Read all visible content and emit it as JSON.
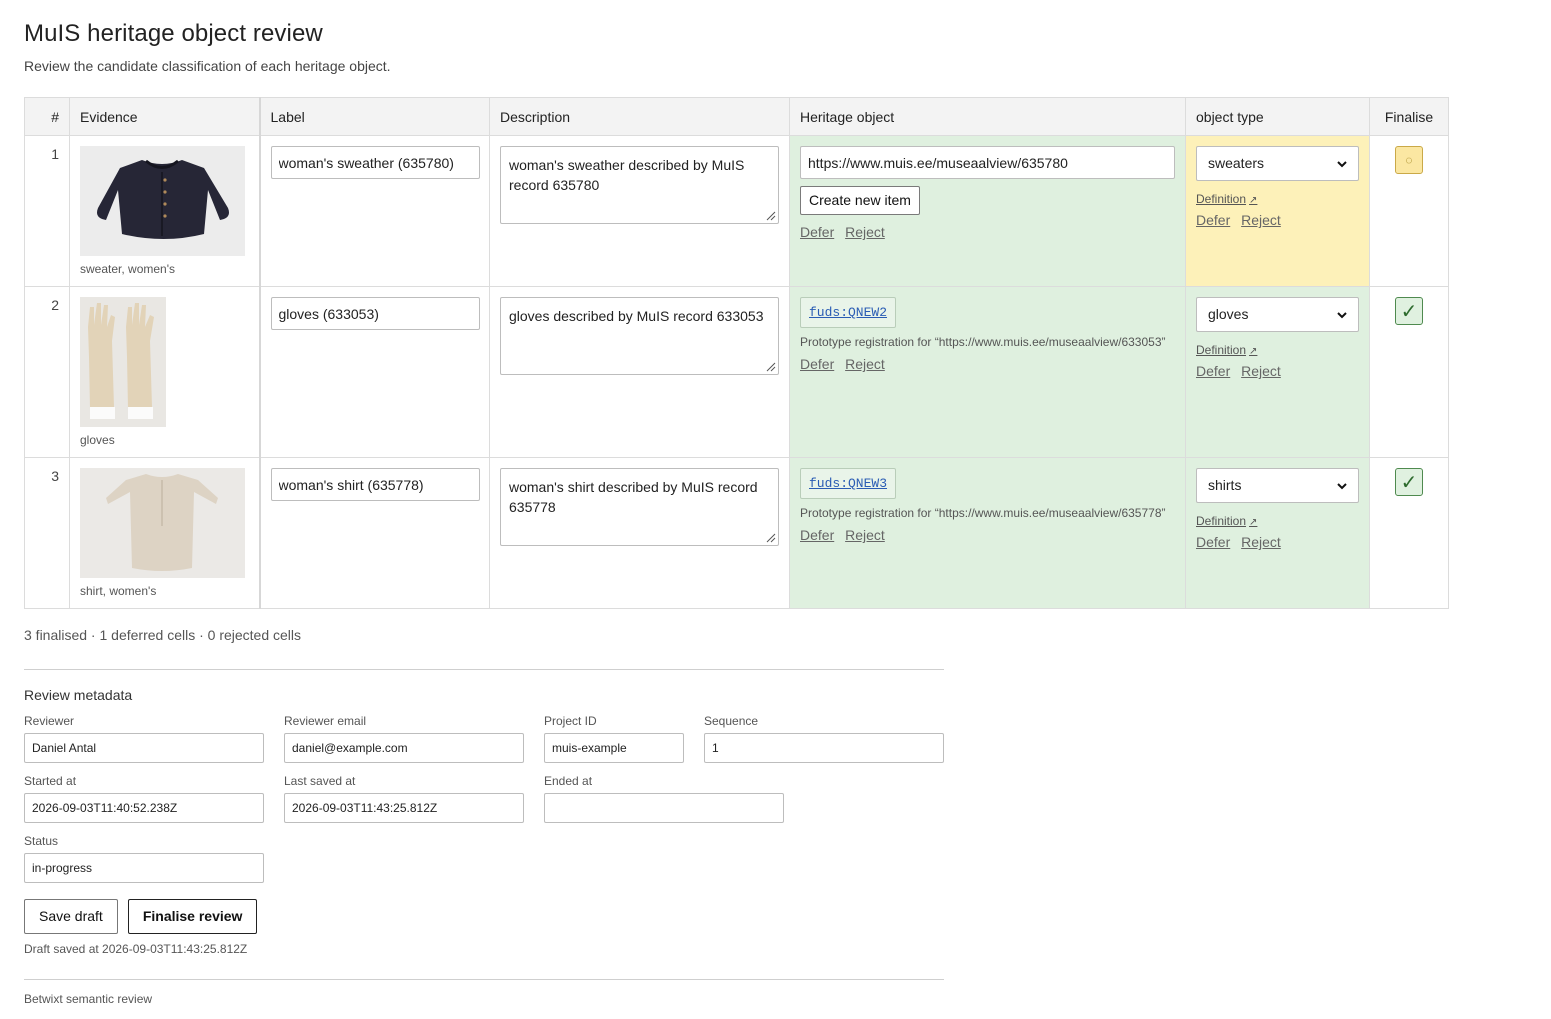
{
  "page": {
    "title": "MuIS heritage object review",
    "subtitle": "Review the candidate classification of each heritage object."
  },
  "columns": {
    "num": "#",
    "evidence": "Evidence",
    "label": "Label",
    "description": "Description",
    "heritage": "Heritage object",
    "type": "object type",
    "finalise": "Finalise"
  },
  "rows": [
    {
      "num": "1",
      "caption": "sweater, women's",
      "label": "woman's sweather (635780)",
      "description": "woman's sweather described by MuIS record 635780",
      "heritage_url": "https://www.muis.ee/museaalview/635780",
      "create_label": "Create new item",
      "defer": "Defer",
      "reject": "Reject",
      "type_value": "sweaters",
      "definition": "Definition",
      "finalise_state": "pending",
      "finalise_glyph": "◌"
    },
    {
      "num": "2",
      "caption": "gloves",
      "label": "gloves (633053)",
      "description": "gloves described by MuIS record 633053",
      "heritage_id": "fuds:QNEW2",
      "prototype": "Prototype registration for “https://www.muis.ee/museaalview/633053”",
      "defer": "Defer",
      "reject": "Reject",
      "type_value": "gloves",
      "definition": "Definition",
      "finalise_state": "done",
      "finalise_glyph": "✓"
    },
    {
      "num": "3",
      "caption": "shirt, women's",
      "label": "woman's shirt (635778)",
      "description": "woman's shirt described by MuIS record 635778",
      "heritage_id": "fuds:QNEW3",
      "prototype": "Prototype registration for “https://www.muis.ee/museaalview/635778”",
      "defer": "Defer",
      "reject": "Reject",
      "type_value": "shirts",
      "definition": "Definition",
      "finalise_state": "done",
      "finalise_glyph": "✓"
    }
  ],
  "summary": "3 finalised · 1 deferred cells · 0 rejected cells",
  "metadata": {
    "title": "Review metadata",
    "reviewer_label": "Reviewer",
    "reviewer": "Daniel Antal",
    "email_label": "Reviewer email",
    "email": "daniel@example.com",
    "project_label": "Project ID",
    "project": "muis-example",
    "sequence_label": "Sequence",
    "sequence": "1",
    "started_label": "Started at",
    "started": "2026-09-03T11:40:52.238Z",
    "saved_label": "Last saved at",
    "saved": "2026-09-03T11:43:25.812Z",
    "ended_label": "Ended at",
    "ended": "",
    "status_label": "Status",
    "status": "in-progress"
  },
  "actions": {
    "save_draft": "Save draft",
    "finalise": "Finalise review",
    "draft_saved": "Draft saved at 2026-09-03T11:43:25.812Z"
  },
  "footer": "Betwixt semantic review",
  "colors": {
    "green_cell": "#dff0df",
    "yellow_cell": "#fdf1b9",
    "link": "#2a5cb4"
  }
}
